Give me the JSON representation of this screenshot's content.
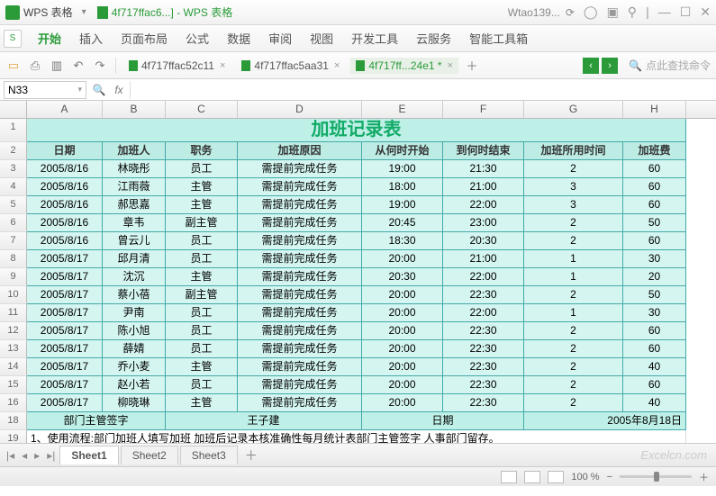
{
  "titlebar": {
    "app_name": "WPS 表格",
    "doc_name": "4f717ffac6...] - WPS 表格",
    "user": "Wtao139..."
  },
  "ribbon": {
    "tabs": [
      "开始",
      "插入",
      "页面布局",
      "公式",
      "数据",
      "审阅",
      "视图",
      "开发工具",
      "云服务",
      "智能工具箱"
    ],
    "active_index": 0
  },
  "qat": {
    "doc_tabs": [
      {
        "label": "4f717ffac52c11",
        "active": false
      },
      {
        "label": "4f717ffac5aa31",
        "active": false
      },
      {
        "label": "4f717ff...24e1 *",
        "active": true
      }
    ],
    "search_placeholder": "点此查找命令"
  },
  "formula_bar": {
    "namebox": "N33",
    "fx": "fx"
  },
  "columns": [
    "A",
    "B",
    "C",
    "D",
    "E",
    "F",
    "G",
    "H"
  ],
  "rows_visible": [
    1,
    2,
    3,
    4,
    5,
    6,
    7,
    8,
    9,
    10,
    11,
    12,
    13,
    14,
    15,
    16,
    18,
    19
  ],
  "chart_data": {
    "type": "table",
    "title": "加班记录表",
    "headers": [
      "日期",
      "加班人",
      "职务",
      "加班原因",
      "从何时开始",
      "到何时结束",
      "加班所用时间",
      "加班费"
    ],
    "rows": [
      [
        "2005/8/16",
        "林晓彤",
        "员工",
        "需提前完成任务",
        "19:00",
        "21:30",
        "2",
        "60"
      ],
      [
        "2005/8/16",
        "江雨薇",
        "主管",
        "需提前完成任务",
        "18:00",
        "21:00",
        "3",
        "60"
      ],
      [
        "2005/8/16",
        "郝思嘉",
        "主管",
        "需提前完成任务",
        "19:00",
        "22:00",
        "3",
        "60"
      ],
      [
        "2005/8/16",
        "章韦",
        "副主管",
        "需提前完成任务",
        "20:45",
        "23:00",
        "2",
        "50"
      ],
      [
        "2005/8/16",
        "曾云儿",
        "员工",
        "需提前完成任务",
        "18:30",
        "20:30",
        "2",
        "60"
      ],
      [
        "2005/8/17",
        "邱月清",
        "员工",
        "需提前完成任务",
        "20:00",
        "21:00",
        "1",
        "30"
      ],
      [
        "2005/8/17",
        "沈沉",
        "主管",
        "需提前完成任务",
        "20:30",
        "22:00",
        "1",
        "20"
      ],
      [
        "2005/8/17",
        "蔡小蓓",
        "副主管",
        "需提前完成任务",
        "20:00",
        "22:30",
        "2",
        "50"
      ],
      [
        "2005/8/17",
        "尹南",
        "员工",
        "需提前完成任务",
        "20:00",
        "22:00",
        "1",
        "30"
      ],
      [
        "2005/8/17",
        "陈小旭",
        "员工",
        "需提前完成任务",
        "20:00",
        "22:30",
        "2",
        "60"
      ],
      [
        "2005/8/17",
        "薛婧",
        "员工",
        "需提前完成任务",
        "20:00",
        "22:30",
        "2",
        "60"
      ],
      [
        "2005/8/17",
        "乔小麦",
        "主管",
        "需提前完成任务",
        "20:00",
        "22:30",
        "2",
        "40"
      ],
      [
        "2005/8/17",
        "赵小若",
        "员工",
        "需提前完成任务",
        "20:00",
        "22:30",
        "2",
        "60"
      ],
      [
        "2005/8/17",
        "柳晓琳",
        "主管",
        "需提前完成任务",
        "20:00",
        "22:30",
        "2",
        "40"
      ]
    ],
    "footer_row18": {
      "label": "部门主管签字",
      "name": "王子建",
      "date_label": "日期",
      "date": "2005年8月18日"
    },
    "footer_row19": "1、使用流程:部门加班人填写加班  加班后记录本核准确性每月统计表部门主管签字  人事部门留存。"
  },
  "sheet_tabs": {
    "tabs": [
      "Sheet1",
      "Sheet2",
      "Sheet3"
    ],
    "active_index": 0
  },
  "statusbar": {
    "zoom": "100 %"
  },
  "watermark": "Excelcn.com"
}
